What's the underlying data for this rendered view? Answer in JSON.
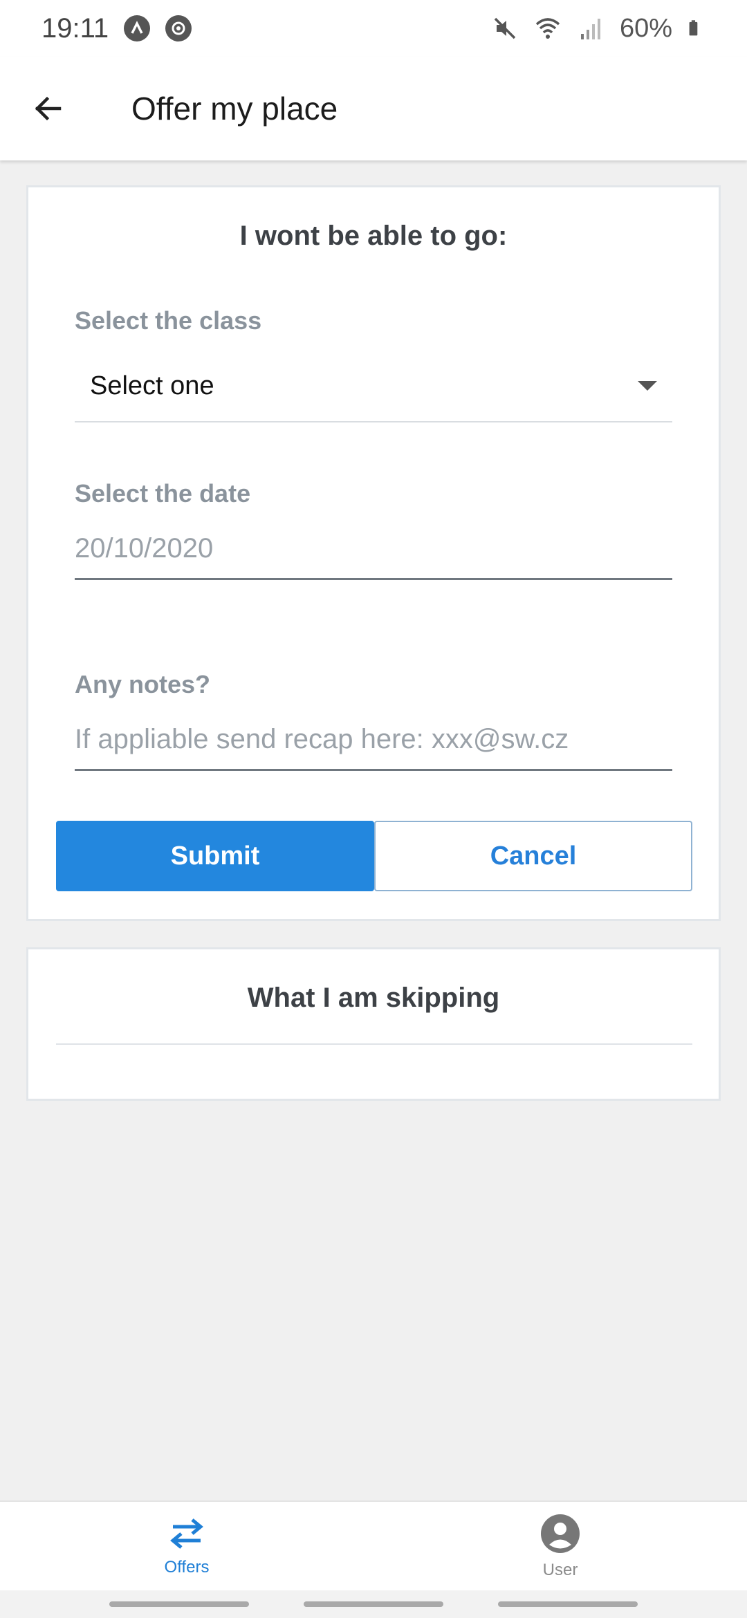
{
  "status_bar": {
    "time": "19:11",
    "notification_icons": [
      "android-a-icon",
      "settings-badge-icon"
    ],
    "system_icons": [
      "mute-icon",
      "wifi-icon",
      "signal-icon",
      "battery-icon"
    ],
    "battery_text": "60%"
  },
  "app_bar": {
    "back_icon": "arrow-left-icon",
    "title": "Offer my place"
  },
  "form": {
    "heading": "I wont be able to go:",
    "class_label": "Select the class",
    "class_value": "Select one",
    "date_label": "Select the date",
    "date_value": "20/10/2020",
    "notes_label": "Any notes?",
    "notes_placeholder": "If appliable send recap here: xxx@sw.cz",
    "submit_label": "Submit",
    "cancel_label": "Cancel"
  },
  "skipping": {
    "heading": "What I am skipping"
  },
  "bottom_nav": {
    "items": [
      {
        "label": "Offers",
        "icon": "swap-arrows-icon",
        "active": true
      },
      {
        "label": "User",
        "icon": "account-circle-icon",
        "active": false
      }
    ]
  },
  "colors": {
    "accent": "#2387de",
    "background": "#f0f0f0",
    "label": "#8a939c",
    "heading": "#3d4146"
  }
}
